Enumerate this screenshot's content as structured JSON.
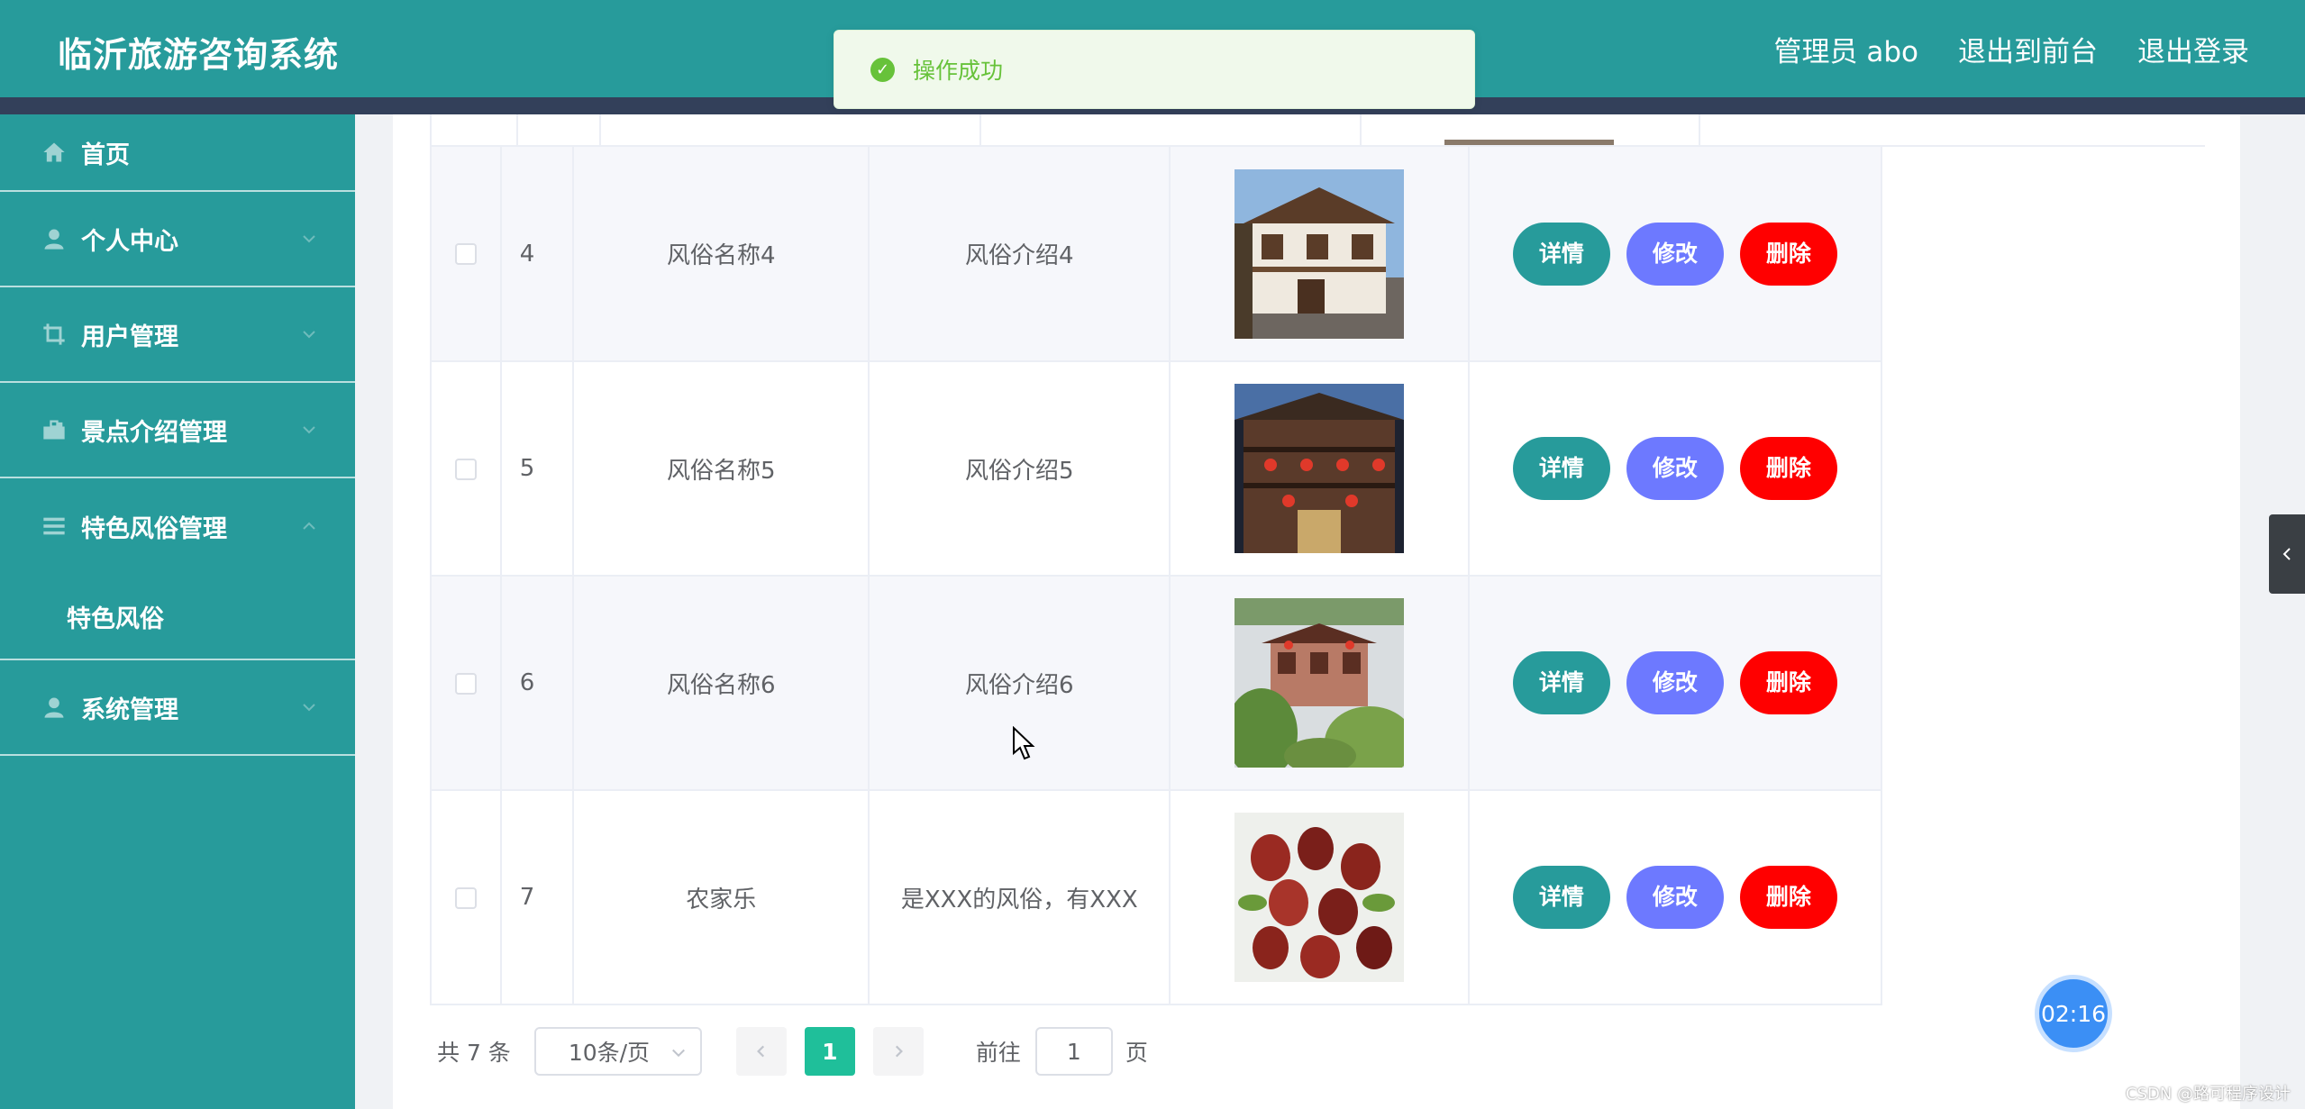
{
  "header": {
    "title": "临沂旅游咨询系统",
    "admin_label": "管理员 abo",
    "back_to_front": "退出到前台",
    "logout": "退出登录",
    "bg_color": "#279b9b"
  },
  "toast": {
    "text": "操作成功",
    "icon": "check-circle-icon"
  },
  "sidebar": {
    "items": [
      {
        "label": "首页",
        "icon": "home-icon"
      },
      {
        "label": "个人中心",
        "icon": "user-icon"
      },
      {
        "label": "用户管理",
        "icon": "crop-icon"
      },
      {
        "label": "景点介绍管理",
        "icon": "briefcase-icon"
      },
      {
        "label": "特色风俗管理",
        "icon": "list-icon"
      },
      {
        "label": "系统管理",
        "icon": "user-icon"
      }
    ],
    "sub_items": [
      {
        "label": "特色风俗"
      }
    ]
  },
  "table": {
    "rows": [
      {
        "index": "4",
        "name": "风俗名称4",
        "desc": "风俗介绍4"
      },
      {
        "index": "5",
        "name": "风俗名称5",
        "desc": "风俗介绍5"
      },
      {
        "index": "6",
        "name": "风俗名称6",
        "desc": "风俗介绍6"
      },
      {
        "index": "7",
        "name": "农家乐",
        "desc": "是XXX的风俗，有XXX"
      }
    ],
    "buttons": {
      "detail": "详情",
      "edit": "修改",
      "delete": "删除"
    }
  },
  "pager": {
    "total": "共 7 条",
    "page_size": "10条/页",
    "current_page": "1",
    "goto_label": "前往",
    "goto_value": "1",
    "page_suffix": "页"
  },
  "timer": "02:16",
  "watermark": "CSDN @路可程序设计"
}
